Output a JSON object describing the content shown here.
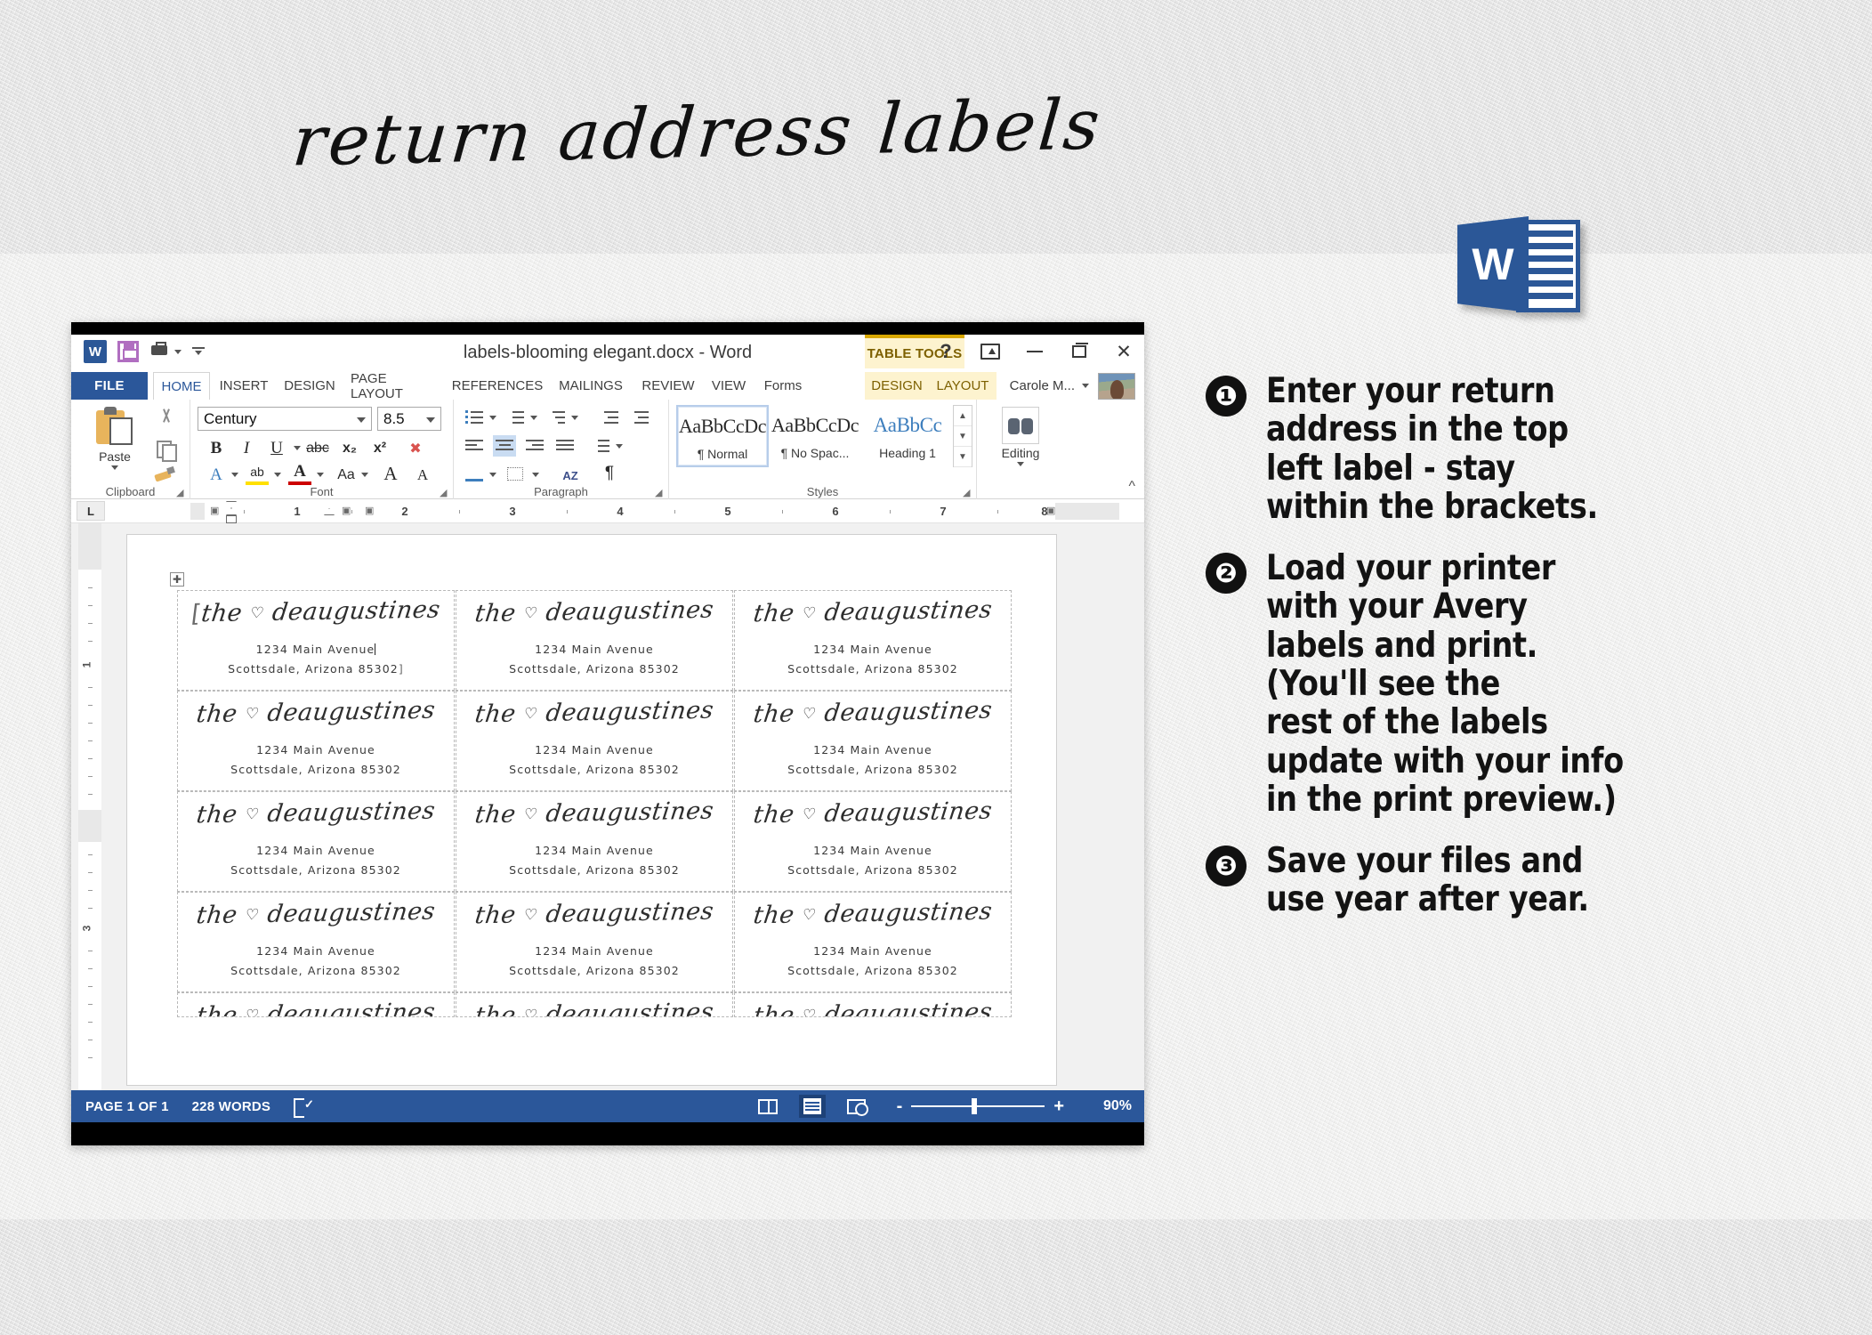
{
  "header": {
    "title": "return address labels",
    "product_icon": "word-product-icon",
    "product_icon_letter": "W"
  },
  "word_window": {
    "titlebar": {
      "document_title": "labels-blooming elegant.docx - Word",
      "quick_access": [
        {
          "name": "word-app-icon",
          "label": "W"
        },
        {
          "name": "save-icon",
          "label": ""
        },
        {
          "name": "undo-icon",
          "label": ""
        },
        {
          "name": "customize-qat-icon",
          "label": ""
        }
      ],
      "contextual_banner": "TABLE TOOLS",
      "window_buttons": [
        "help-icon",
        "ribbon-display-options-icon",
        "minimize-icon",
        "restore-icon",
        "close-icon"
      ],
      "user_name": "Carole M..."
    },
    "tabs": [
      {
        "label": "FILE",
        "state": "file"
      },
      {
        "label": "HOME",
        "state": "active"
      },
      {
        "label": "INSERT",
        "state": "normal"
      },
      {
        "label": "DESIGN",
        "state": "normal"
      },
      {
        "label": "PAGE LAYOUT",
        "state": "normal"
      },
      {
        "label": "REFERENCES",
        "state": "normal"
      },
      {
        "label": "MAILINGS",
        "state": "normal"
      },
      {
        "label": "REVIEW",
        "state": "normal"
      },
      {
        "label": "VIEW",
        "state": "normal"
      },
      {
        "label": "Forms",
        "state": "normal"
      },
      {
        "label": "DESIGN",
        "state": "tabletools"
      },
      {
        "label": "LAYOUT",
        "state": "tabletools"
      }
    ],
    "ribbon": {
      "groups": [
        {
          "name": "Clipboard",
          "label": "Clipboard"
        },
        {
          "name": "Font",
          "label": "Font"
        },
        {
          "name": "Paragraph",
          "label": "Paragraph"
        },
        {
          "name": "Styles",
          "label": "Styles"
        },
        {
          "name": "Editing",
          "label": "Editing"
        }
      ],
      "clipboard": {
        "paste_label": "Paste",
        "buttons": [
          "cut-icon",
          "copy-icon",
          "format-painter-icon"
        ]
      },
      "font": {
        "font_name": "Century",
        "font_size": "8.5",
        "buttons": [
          "bold",
          "italic",
          "underline",
          "strikethrough",
          "subscript",
          "superscript",
          "clear-formatting",
          "text-effects",
          "text-highlight-color",
          "font-color",
          "change-case",
          "grow-font",
          "shrink-font"
        ],
        "bold_label": "B",
        "italic_label": "I",
        "underline_label": "U",
        "strikethrough_label": "abc",
        "subscript_label": "x₂",
        "superscript_label": "x²",
        "text_effects_label": "A",
        "highlight_label": "ab",
        "font_color_label": "A",
        "change_case_label": "Aa",
        "grow_label": "A",
        "shrink_label": "A"
      },
      "paragraph": {
        "buttons": [
          "bullets",
          "numbering",
          "multilevel-list",
          "decrease-indent",
          "increase-indent",
          "align-left",
          "center",
          "align-right",
          "justify",
          "line-spacing",
          "shading",
          "borders",
          "sort",
          "show-formatting-marks"
        ],
        "active": "center",
        "sort_label": "AZ",
        "marks_label": "¶"
      },
      "styles": {
        "items": [
          {
            "sample": "AaBbCcDc",
            "name": "¶ Normal",
            "selected": true,
            "blue": false
          },
          {
            "sample": "AaBbCcDc",
            "name": "¶ No Spac...",
            "selected": false,
            "blue": false
          },
          {
            "sample": "AaBbCc",
            "name": "Heading 1",
            "selected": false,
            "blue": true
          }
        ],
        "scroll_buttons": [
          "scroll-up",
          "scroll-down",
          "more-styles"
        ]
      },
      "editing": {
        "label": "Editing",
        "icon": "binoculars-icon"
      },
      "collapse_label": "^"
    },
    "ruler": {
      "tab_selector": "L",
      "h_ticks": [
        "1",
        "2",
        "3",
        "4",
        "5",
        "6",
        "7",
        "8"
      ],
      "v_ticks": [
        "1",
        "3"
      ]
    },
    "document": {
      "label_grid": {
        "rows": 4,
        "cols": 3,
        "cell": {
          "script_prefix": "the",
          "script_heart": "♡",
          "script_name": "deaugustines",
          "address_line1": "1234 Main Avenue",
          "address_line2": "Scottsdale, Arizona 85302",
          "bracket_open": "[",
          "bracket_close": "]"
        }
      }
    },
    "statusbar": {
      "page_indicator": "PAGE 1 OF 1",
      "word_count": "228 WORDS",
      "proofing_icon": "proofing-errors-icon",
      "views": [
        {
          "name": "read-mode-view",
          "selected": false
        },
        {
          "name": "print-layout-view",
          "selected": true
        },
        {
          "name": "web-layout-view",
          "selected": false
        }
      ],
      "zoom_out_label": "-",
      "zoom_in_label": "+",
      "zoom_level": "90%"
    }
  },
  "steps": [
    {
      "number": "❶",
      "text": "Enter your return\naddress in the top\nleft label - stay\nwithin the brackets."
    },
    {
      "number": "❷",
      "text": "Load your printer\nwith your Avery\nlabels and print.\n(You'll see the\nrest of the labels\nupdate with your info\nin the print preview.)"
    },
    {
      "number": "❸",
      "text": "Save your files and\nuse year after year."
    }
  ],
  "colors": {
    "word_blue": "#2b579a",
    "accent_yellow": "#fdf3cf",
    "page_bg": "#f1f1f0"
  }
}
